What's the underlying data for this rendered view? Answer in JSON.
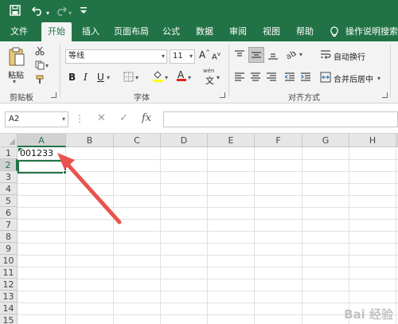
{
  "quick_access": {
    "save_icon": "save-icon",
    "undo_icon": "undo-icon",
    "redo_icon": "redo-icon",
    "customize_icon": "customize-icon"
  },
  "tabs": {
    "file": "文件",
    "home": "开始",
    "insert": "插入",
    "page_layout": "页面布局",
    "formulas": "公式",
    "data": "数据",
    "review": "审阅",
    "view": "视图",
    "help": "帮助",
    "tell_me": "操作说明搜索"
  },
  "ribbon": {
    "clipboard": {
      "paste_label": "粘贴",
      "group_label": "剪贴板"
    },
    "font": {
      "font_name": "等线",
      "font_size": "11",
      "group_label": "字体",
      "wen_label": "wén",
      "wen_char": "文"
    },
    "alignment": {
      "wrap_text": "自动换行",
      "merge_center": "合并后居中",
      "group_label": "对齐方式"
    }
  },
  "formula_bar": {
    "name_box": "A2",
    "fx": "fx",
    "cancel": "✕",
    "enter": "✓",
    "value": ""
  },
  "sheet": {
    "columns": [
      "A",
      "B",
      "C",
      "D",
      "E",
      "F",
      "G",
      "H"
    ],
    "rows": [
      "1",
      "2",
      "3",
      "4",
      "5",
      "6",
      "7",
      "8",
      "9",
      "10",
      "11",
      "12",
      "13",
      "14",
      "15"
    ],
    "cell_a1": "001233",
    "selected_cell": "A2"
  },
  "annotation": {
    "arrow_color": "#e8534d"
  },
  "colors": {
    "accent": "#217346",
    "ribbon_bg": "#f3f3f3",
    "header_bg": "#e6e6e6"
  },
  "watermark": "Bai 经验"
}
